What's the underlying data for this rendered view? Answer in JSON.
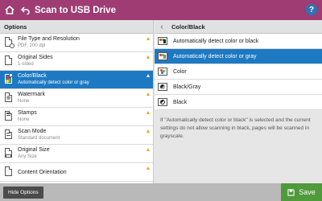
{
  "header": {
    "title": "Scan to USB Drive",
    "help_label": "?"
  },
  "options": {
    "heading": "Options",
    "items": [
      {
        "name": "File Type and Resolution",
        "value": "PDF, 200 dpi",
        "warning": true
      },
      {
        "name": "Original Sides",
        "value": "1-sided",
        "warning": true
      },
      {
        "name": "Color/Black",
        "value": "Automatically detect color or gray",
        "warning": true,
        "selected": true
      },
      {
        "name": "Watermark",
        "value": "None",
        "warning": true
      },
      {
        "name": "Stamps",
        "value": "None",
        "warning": true
      },
      {
        "name": "Scan Mode",
        "value": "Standard document",
        "warning": true
      },
      {
        "name": "Original Size",
        "value": "Any Size",
        "warning": true
      },
      {
        "name": "Content Orientation",
        "value": "",
        "warning": true
      }
    ]
  },
  "detail": {
    "heading": "Color/Black",
    "choices": [
      {
        "label": "Automatically detect color or black",
        "icon": "auto-color-black-icon"
      },
      {
        "label": "Automatically detect color or gray",
        "icon": "auto-color-gray-icon",
        "selected": true
      },
      {
        "label": "Color",
        "icon": "color-icon"
      },
      {
        "label": "Black/Gray",
        "icon": "black-gray-icon"
      },
      {
        "label": "Black",
        "icon": "black-icon"
      }
    ],
    "note": "If \"Automatically detect color or black\" is selected and the current settings do not allow scanning in black, pages will be scanned in grayscale."
  },
  "footer": {
    "hide_label": "Hide Options",
    "save_label": "Save"
  },
  "colors": {
    "header": "#9e3c73",
    "selected": "#1e79c3",
    "warning": "#e8a319",
    "save": "#4f9a3b",
    "help": "#2c73b6"
  }
}
